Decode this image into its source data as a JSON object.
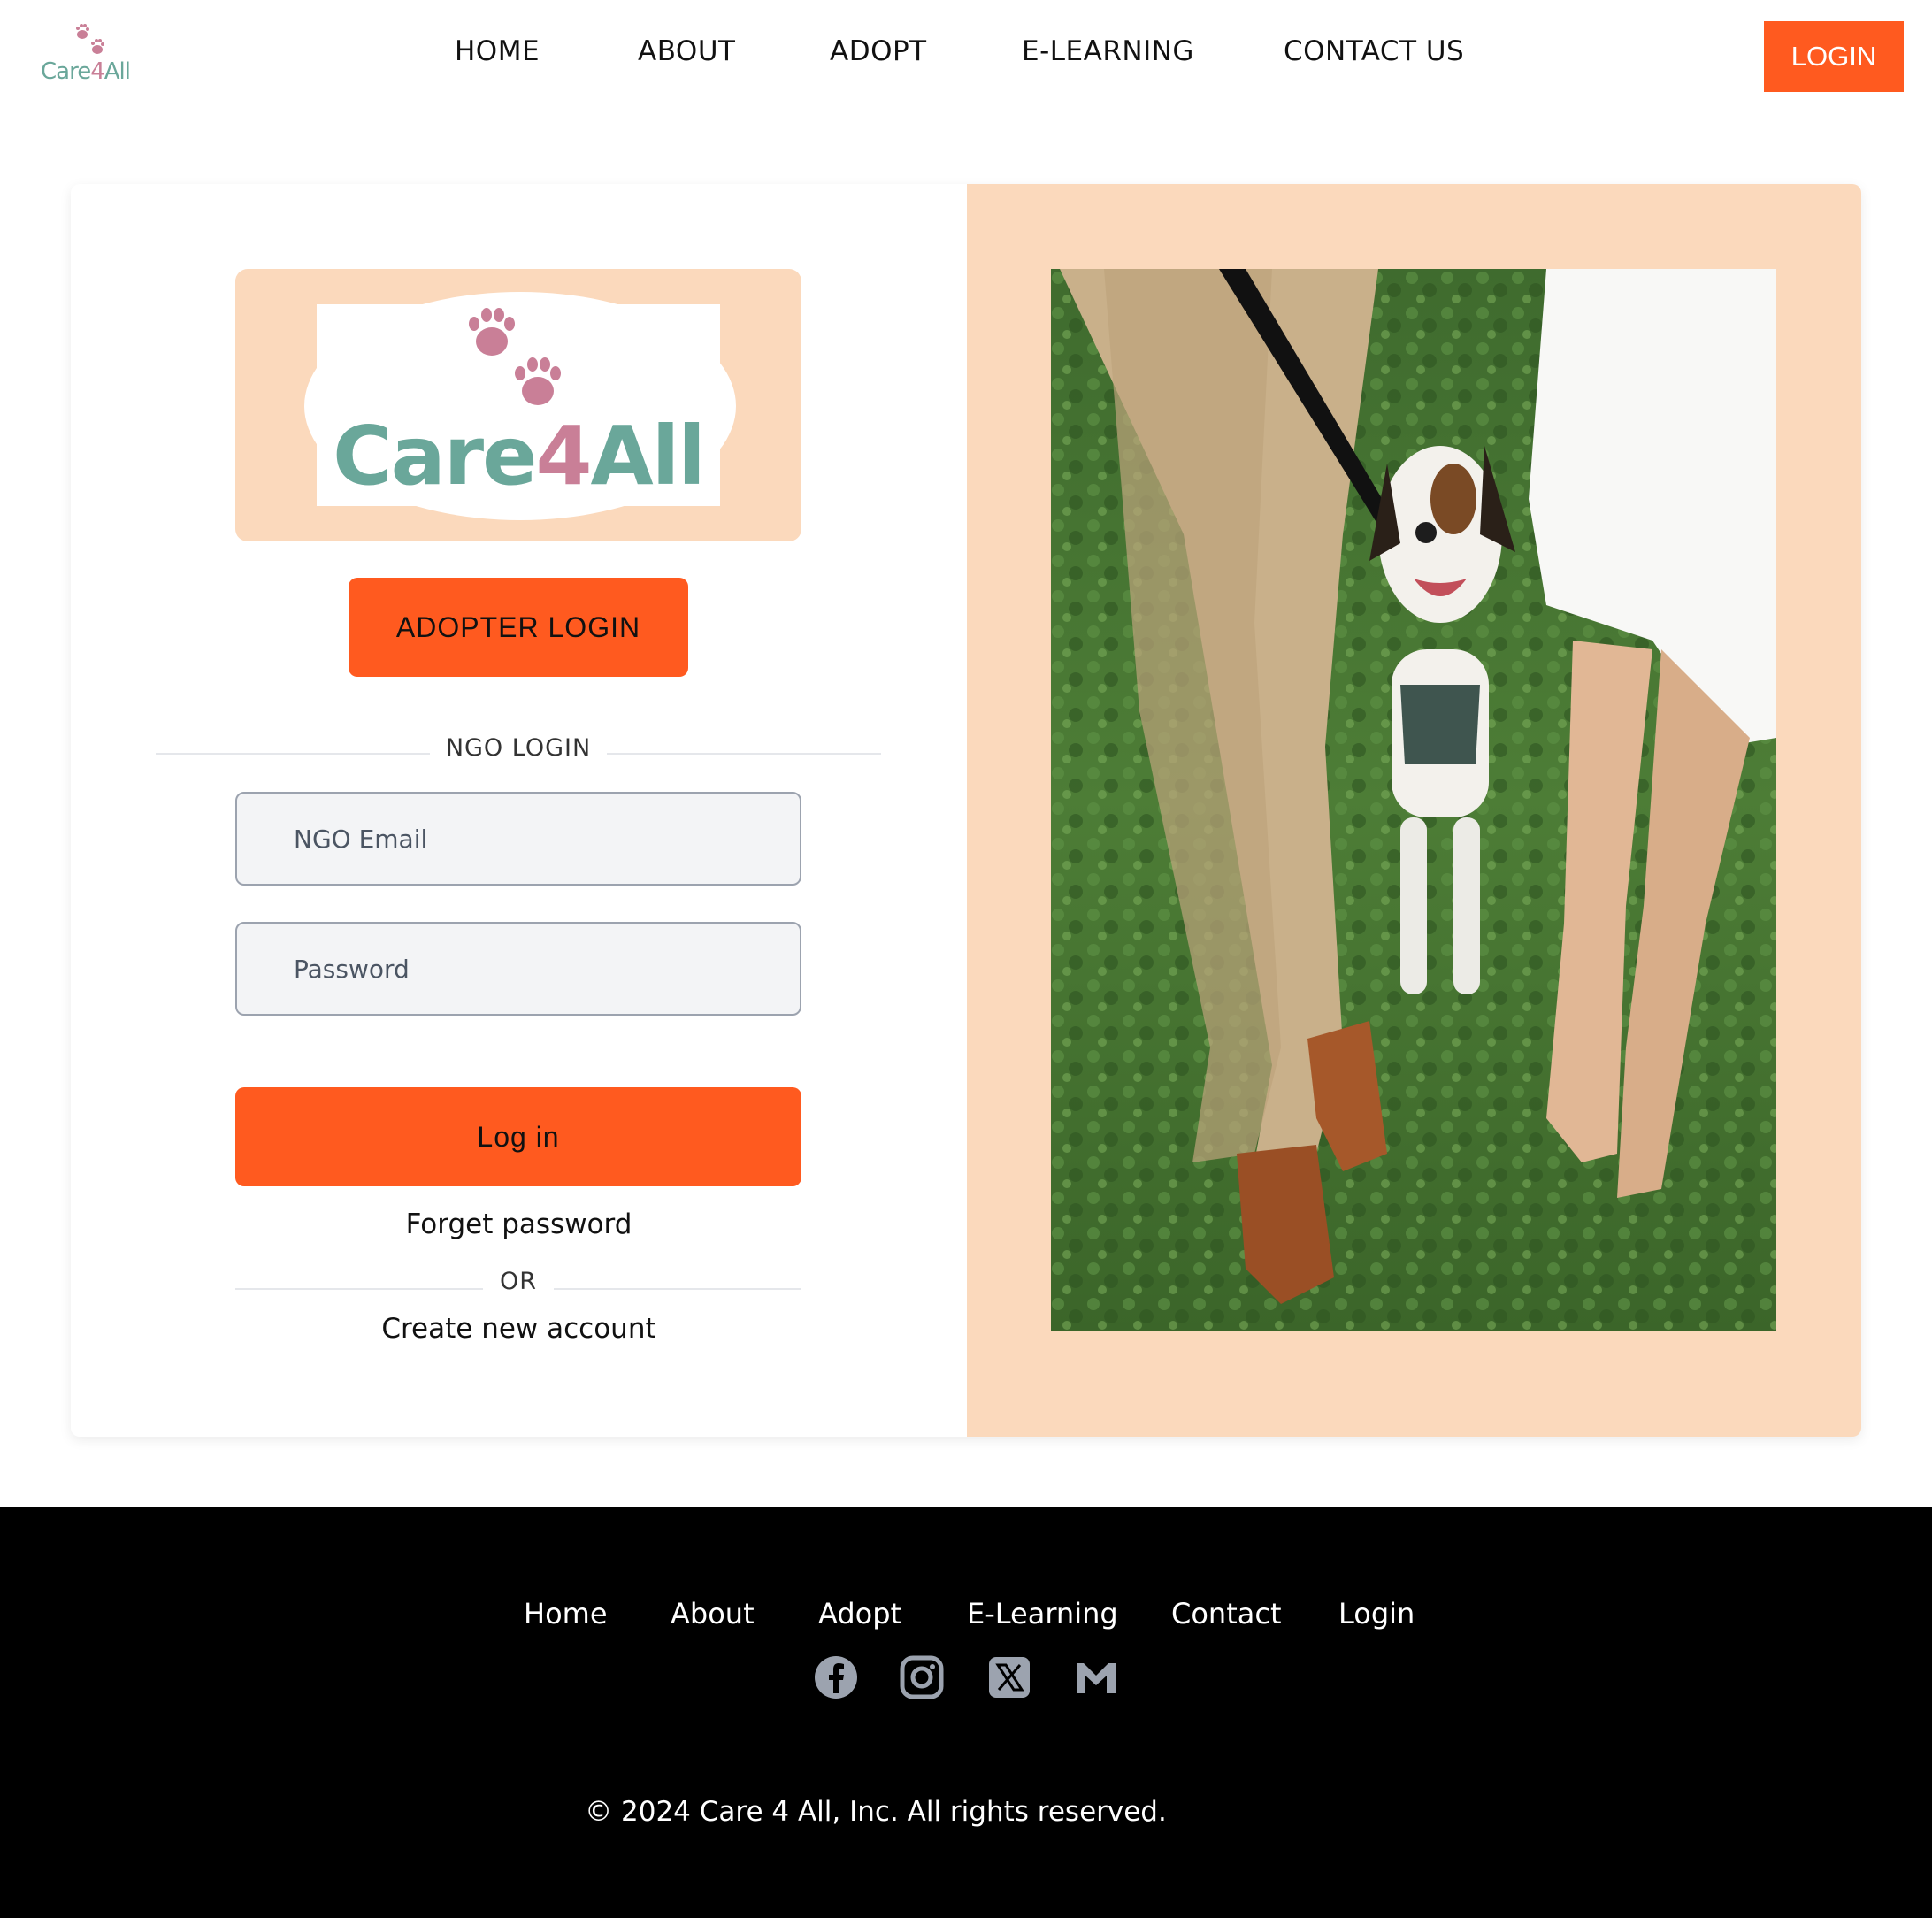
{
  "brand": {
    "logo_word": "Care",
    "logo_four": "4",
    "logo_tail": "All"
  },
  "nav": {
    "home": "HOME",
    "about": "ABOUT",
    "adopt": "ADOPT",
    "elearning": "E-LEARNING",
    "contact": "CONTACT US",
    "login": "LOGIN"
  },
  "login_panel": {
    "adopter_login": "ADOPTER LOGIN",
    "ngo_login_heading": "NGO LOGIN",
    "email_placeholder": "NGO Email",
    "password_placeholder": "Password",
    "submit_label": "Log in",
    "forgot_password": "Forget password",
    "or_label": "OR",
    "create_account": "Create new account"
  },
  "footer": {
    "links": [
      "Home",
      "About",
      "Adopt",
      "E-Learning",
      "Contact",
      "Login"
    ],
    "social_icons": [
      "facebook-icon",
      "instagram-icon",
      "x-icon",
      "gmail-icon"
    ],
    "copyright": "© 2024 Care 4 All, Inc. All rights reserved."
  },
  "colors": {
    "accent": "#ff5a1f",
    "peach": "#fbd9bc",
    "logo_teal": "#6aa79a",
    "logo_pink": "#c97f97",
    "footer_bg": "#000000"
  }
}
